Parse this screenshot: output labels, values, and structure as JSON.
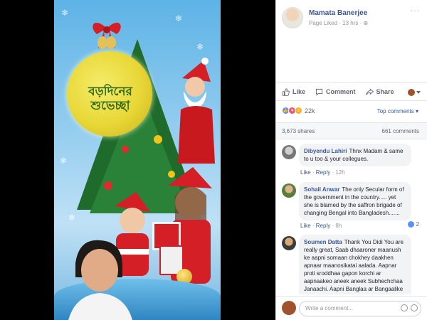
{
  "post": {
    "page_name": "Mamata Banerjee",
    "page_meta": "Page Liked · 13 hrs · ",
    "more": "···",
    "image_text": "বড়দিনের শুভেচ্ছা"
  },
  "actions": {
    "like": "Like",
    "comment": "Comment",
    "share": "Share"
  },
  "reactions": {
    "count": "22k",
    "top_comments": "Top comments ▾"
  },
  "stats": {
    "shares": "3,673 shares",
    "comments": "661 comments"
  },
  "comments": [
    {
      "name": "Dibyendu Lahiri",
      "text": "Thnx Madam & same to u too & your collegues.",
      "like": "Like",
      "reply": "Reply",
      "time": "12h",
      "likes": ""
    },
    {
      "name": "Sohail Anwar",
      "text": "The only Secular form of the government in the country..... yet she is blamed by the saffron brigade of changing Bengal into Bangladesh.......",
      "like": "Like",
      "reply": "Reply",
      "time": "8h",
      "likes": "2"
    },
    {
      "name": "Soumen Datta",
      "text": "Thank You Didi You are really great, Saab dhaaroner maanush ke aapni somaan chokhey daakhen apnaar maanosikatai aalada. Aapnar proti sroddhaa gapon korchi ar aapnaakeo aneek aneek Subhechchaa Janaachi. Aapni Banglaa ar Bangaalike aro egiye give"
    }
  ],
  "composer": {
    "placeholder": "Write a comment..."
  },
  "colors": {
    "link": "#365899",
    "like_blue": "#5890ff",
    "love_red": "#f25268",
    "haha_yellow": "#f7b125"
  }
}
